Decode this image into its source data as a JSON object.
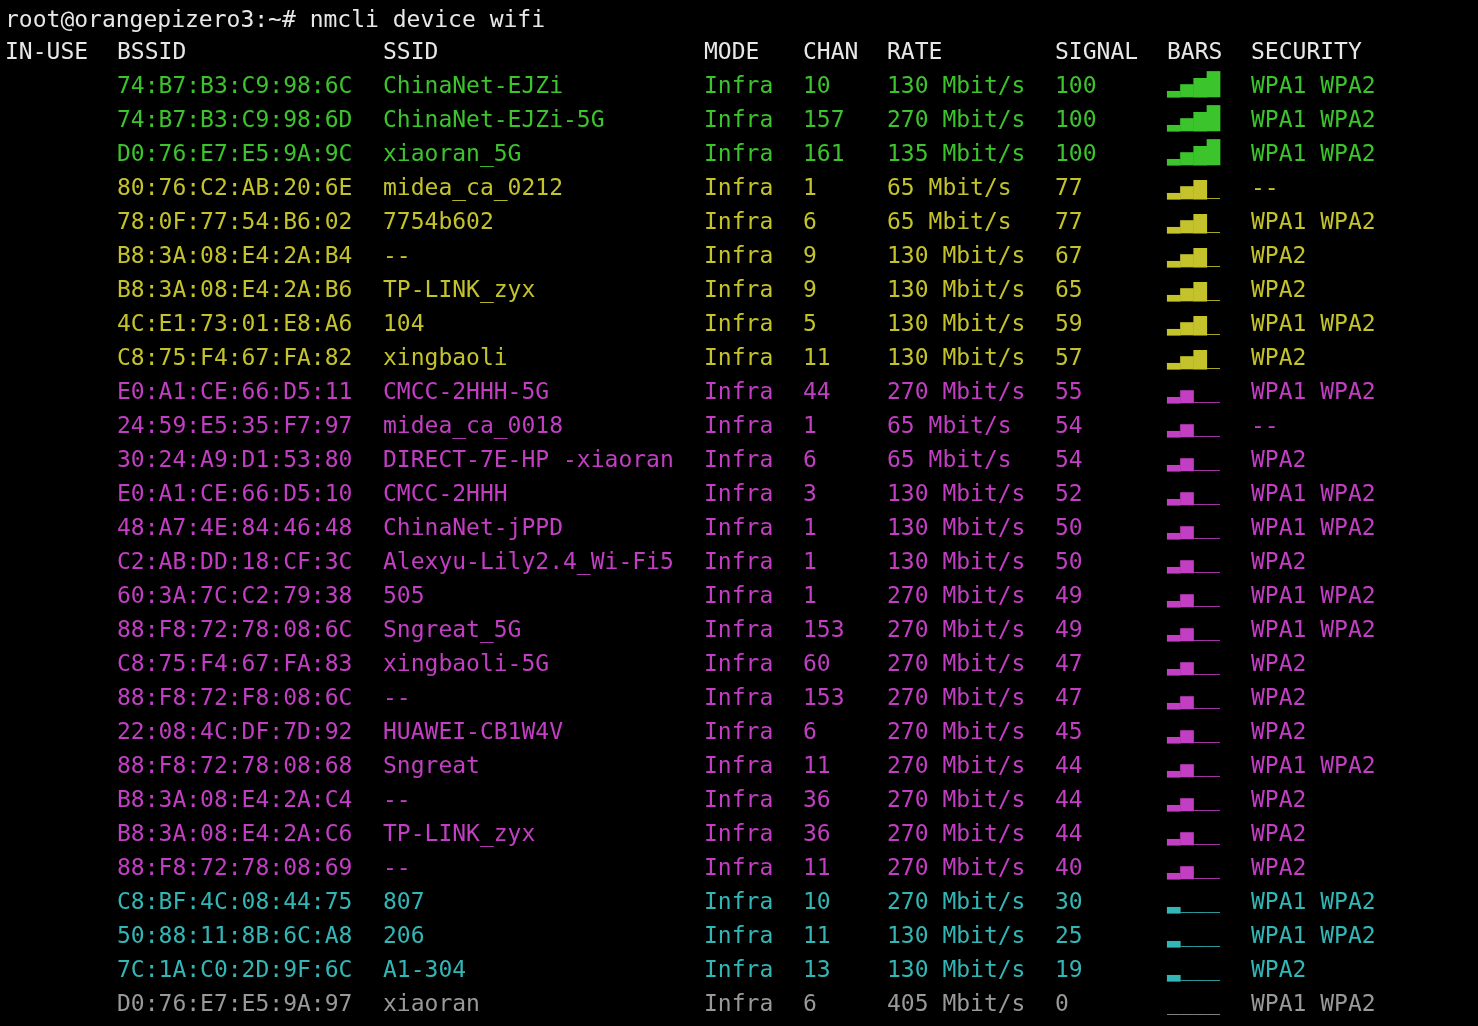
{
  "prompt": "root@orangepizero3:~# nmcli device wifi",
  "columns": [
    "IN-USE",
    "BSSID",
    "SSID",
    "MODE",
    "CHAN",
    "RATE",
    "SIGNAL",
    "BARS",
    "SECURITY"
  ],
  "rows": [
    {
      "bssid": "74:B7:B3:C9:98:6C",
      "ssid": "ChinaNet-EJZi",
      "mode": "Infra",
      "chan": "10",
      "rate": "130 Mbit/s",
      "signal": "100",
      "bars": "▂▄▆█",
      "security": "WPA1 WPA2",
      "color": "#3cc42c"
    },
    {
      "bssid": "74:B7:B3:C9:98:6D",
      "ssid": "ChinaNet-EJZi-5G",
      "mode": "Infra",
      "chan": "157",
      "rate": "270 Mbit/s",
      "signal": "100",
      "bars": "▂▄▆█",
      "security": "WPA1 WPA2",
      "color": "#3cc42c"
    },
    {
      "bssid": "D0:76:E7:E5:9A:9C",
      "ssid": "xiaoran_5G",
      "mode": "Infra",
      "chan": "161",
      "rate": "135 Mbit/s",
      "signal": "100",
      "bars": "▂▄▆█",
      "security": "WPA1 WPA2",
      "color": "#3cc42c"
    },
    {
      "bssid": "80:76:C2:AB:20:6E",
      "ssid": "midea_ca_0212",
      "mode": "Infra",
      "chan": "1",
      "rate": "65 Mbit/s",
      "signal": "77",
      "bars": "▂▄▆_",
      "security": "--",
      "color": "#c4c32c"
    },
    {
      "bssid": "78:0F:77:54:B6:02",
      "ssid": "7754b602",
      "mode": "Infra",
      "chan": "6",
      "rate": "65 Mbit/s",
      "signal": "77",
      "bars": "▂▄▆_",
      "security": "WPA1 WPA2",
      "color": "#c4c32c"
    },
    {
      "bssid": "B8:3A:08:E4:2A:B4",
      "ssid": "--",
      "mode": "Infra",
      "chan": "9",
      "rate": "130 Mbit/s",
      "signal": "67",
      "bars": "▂▄▆_",
      "security": "WPA2",
      "color": "#c4c32c"
    },
    {
      "bssid": "B8:3A:08:E4:2A:B6",
      "ssid": "TP-LINK_zyx",
      "mode": "Infra",
      "chan": "9",
      "rate": "130 Mbit/s",
      "signal": "65",
      "bars": "▂▄▆_",
      "security": "WPA2",
      "color": "#c4c32c"
    },
    {
      "bssid": "4C:E1:73:01:E8:A6",
      "ssid": "104",
      "mode": "Infra",
      "chan": "5",
      "rate": "130 Mbit/s",
      "signal": "59",
      "bars": "▂▄▆_",
      "security": "WPA1 WPA2",
      "color": "#c4c32c"
    },
    {
      "bssid": "C8:75:F4:67:FA:82",
      "ssid": "xingbaoli",
      "mode": "Infra",
      "chan": "11",
      "rate": "130 Mbit/s",
      "signal": "57",
      "bars": "▂▄▆_",
      "security": "WPA2",
      "color": "#c4c32c"
    },
    {
      "bssid": "E0:A1:CE:66:D5:11",
      "ssid": "CMCC-2HHH-5G",
      "mode": "Infra",
      "chan": "44",
      "rate": "270 Mbit/s",
      "signal": "55",
      "bars": "▂▄__",
      "security": "WPA1 WPA2",
      "color": "#c23ec2"
    },
    {
      "bssid": "24:59:E5:35:F7:97",
      "ssid": "midea_ca_0018",
      "mode": "Infra",
      "chan": "1",
      "rate": "65 Mbit/s",
      "signal": "54",
      "bars": "▂▄__",
      "security": "--",
      "color": "#c23ec2"
    },
    {
      "bssid": "30:24:A9:D1:53:80",
      "ssid": "DIRECT-7E-HP -xiaoran",
      "mode": "Infra",
      "chan": "6",
      "rate": "65 Mbit/s",
      "signal": "54",
      "bars": "▂▄__",
      "security": "WPA2",
      "color": "#c23ec2"
    },
    {
      "bssid": "E0:A1:CE:66:D5:10",
      "ssid": "CMCC-2HHH",
      "mode": "Infra",
      "chan": "3",
      "rate": "130 Mbit/s",
      "signal": "52",
      "bars": "▂▄__",
      "security": "WPA1 WPA2",
      "color": "#c23ec2"
    },
    {
      "bssid": "48:A7:4E:84:46:48",
      "ssid": "ChinaNet-jPPD",
      "mode": "Infra",
      "chan": "1",
      "rate": "130 Mbit/s",
      "signal": "50",
      "bars": "▂▄__",
      "security": "WPA1 WPA2",
      "color": "#c23ec2"
    },
    {
      "bssid": "C2:AB:DD:18:CF:3C",
      "ssid": "Alexyu-Lily2.4_Wi-Fi5",
      "mode": "Infra",
      "chan": "1",
      "rate": "130 Mbit/s",
      "signal": "50",
      "bars": "▂▄__",
      "security": "WPA2",
      "color": "#c23ec2"
    },
    {
      "bssid": "60:3A:7C:C2:79:38",
      "ssid": "505",
      "mode": "Infra",
      "chan": "1",
      "rate": "270 Mbit/s",
      "signal": "49",
      "bars": "▂▄__",
      "security": "WPA1 WPA2",
      "color": "#c23ec2"
    },
    {
      "bssid": "88:F8:72:78:08:6C",
      "ssid": "Sngreat_5G",
      "mode": "Infra",
      "chan": "153",
      "rate": "270 Mbit/s",
      "signal": "49",
      "bars": "▂▄__",
      "security": "WPA1 WPA2",
      "color": "#c23ec2"
    },
    {
      "bssid": "C8:75:F4:67:FA:83",
      "ssid": "xingbaoli-5G",
      "mode": "Infra",
      "chan": "60",
      "rate": "270 Mbit/s",
      "signal": "47",
      "bars": "▂▄__",
      "security": "WPA2",
      "color": "#c23ec2"
    },
    {
      "bssid": "88:F8:72:F8:08:6C",
      "ssid": "--",
      "mode": "Infra",
      "chan": "153",
      "rate": "270 Mbit/s",
      "signal": "47",
      "bars": "▂▄__",
      "security": "WPA2",
      "color": "#c23ec2"
    },
    {
      "bssid": "22:08:4C:DF:7D:92",
      "ssid": "HUAWEI-CB1W4V",
      "mode": "Infra",
      "chan": "6",
      "rate": "270 Mbit/s",
      "signal": "45",
      "bars": "▂▄__",
      "security": "WPA2",
      "color": "#c23ec2"
    },
    {
      "bssid": "88:F8:72:78:08:68",
      "ssid": "Sngreat",
      "mode": "Infra",
      "chan": "11",
      "rate": "270 Mbit/s",
      "signal": "44",
      "bars": "▂▄__",
      "security": "WPA1 WPA2",
      "color": "#c23ec2"
    },
    {
      "bssid": "B8:3A:08:E4:2A:C4",
      "ssid": "--",
      "mode": "Infra",
      "chan": "36",
      "rate": "270 Mbit/s",
      "signal": "44",
      "bars": "▂▄__",
      "security": "WPA2",
      "color": "#c23ec2"
    },
    {
      "bssid": "B8:3A:08:E4:2A:C6",
      "ssid": "TP-LINK_zyx",
      "mode": "Infra",
      "chan": "36",
      "rate": "270 Mbit/s",
      "signal": "44",
      "bars": "▂▄__",
      "security": "WPA2",
      "color": "#c23ec2"
    },
    {
      "bssid": "88:F8:72:78:08:69",
      "ssid": "--",
      "mode": "Infra",
      "chan": "11",
      "rate": "270 Mbit/s",
      "signal": "40",
      "bars": "▂▄__",
      "security": "WPA2",
      "color": "#c23ec2"
    },
    {
      "bssid": "C8:BF:4C:08:44:75",
      "ssid": "807",
      "mode": "Infra",
      "chan": "10",
      "rate": "270 Mbit/s",
      "signal": "30",
      "bars": "▂___",
      "security": "WPA1 WPA2",
      "color": "#33b6b6"
    },
    {
      "bssid": "50:88:11:8B:6C:A8",
      "ssid": "206",
      "mode": "Infra",
      "chan": "11",
      "rate": "130 Mbit/s",
      "signal": "25",
      "bars": "▂___",
      "security": "WPA1 WPA2",
      "color": "#33b6b6"
    },
    {
      "bssid": "7C:1A:C0:2D:9F:6C",
      "ssid": "A1-304",
      "mode": "Infra",
      "chan": "13",
      "rate": "130 Mbit/s",
      "signal": "19",
      "bars": "▂___",
      "security": "WPA2",
      "color": "#33b6b6"
    },
    {
      "bssid": "D0:76:E7:E5:9A:97",
      "ssid": "xiaoran",
      "mode": "Infra",
      "chan": "6",
      "rate": "405 Mbit/s",
      "signal": "0",
      "bars": "____",
      "security": "WPA1 WPA2",
      "color": "#999999"
    }
  ]
}
